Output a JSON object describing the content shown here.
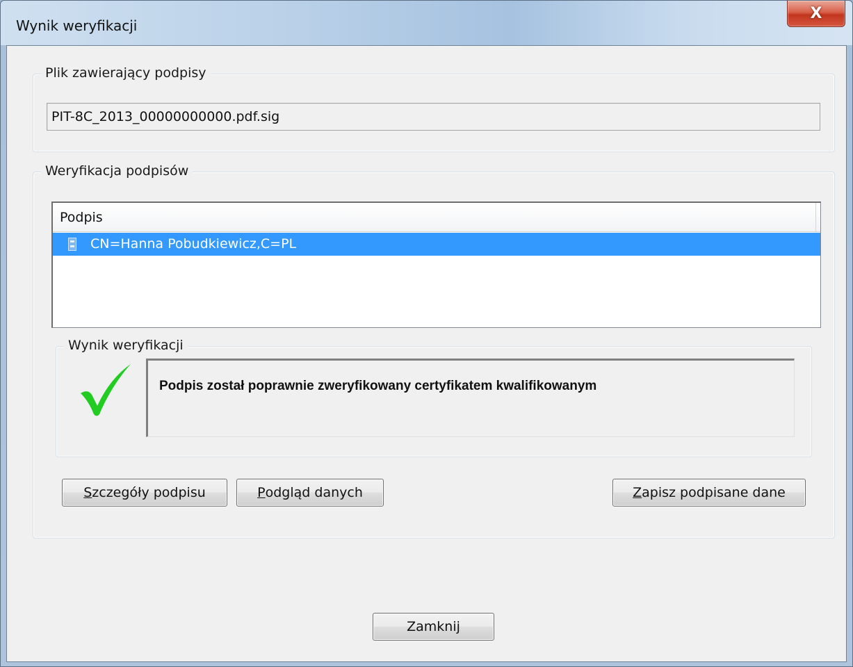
{
  "window": {
    "title": "Wynik weryfikacji",
    "close_label": "X"
  },
  "file_group": {
    "label": "Plik zawierający podpisy",
    "filename": "PIT-8C_2013_00000000000.pdf.sig"
  },
  "verification_group": {
    "label": "Weryfikacja podpisów",
    "list": {
      "column_header": "Podpis",
      "rows": [
        {
          "label": "CN=Hanna Pobudkiewicz,C=PL",
          "selected": true
        }
      ]
    },
    "result": {
      "label": "Wynik weryfikacji",
      "icon": "checkmark-icon",
      "message": "Podpis został poprawnie zweryfikowany certyfikatem kwalifikowanym"
    },
    "buttons": {
      "details": {
        "mnemonic": "S",
        "rest": "zczegóły podpisu"
      },
      "preview": {
        "mnemonic": "P",
        "rest": "odgląd danych"
      },
      "save": {
        "mnemonic": "Z",
        "rest": "apisz podpisane dane"
      }
    }
  },
  "footer": {
    "close_button": "Zamknij"
  },
  "colors": {
    "selection": "#3399ff",
    "checkmark": "#22cc22",
    "close_button": "#c7432b"
  }
}
